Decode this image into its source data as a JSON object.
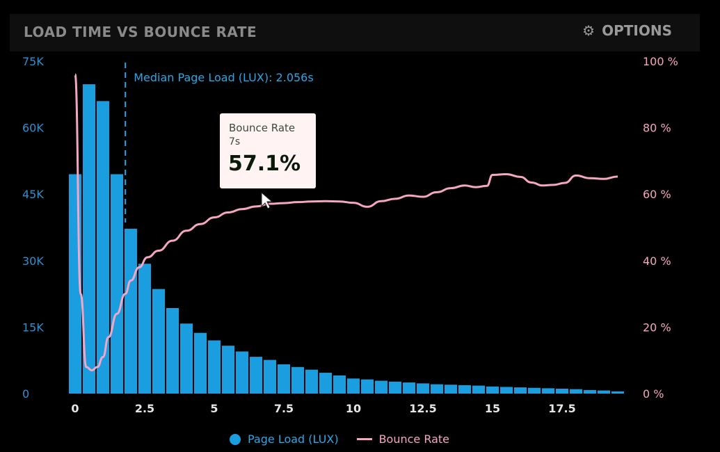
{
  "header": {
    "title": "LOAD TIME VS BOUNCE RATE",
    "options_label": "OPTIONS",
    "options_icon": "gear-icon"
  },
  "colors": {
    "bars": "#1a9ee0",
    "line": "#f5a6c4",
    "left_axis": "#2f8fd0",
    "right_axis": "#f5a6c4",
    "median_line": "#2aa6e6"
  },
  "tooltip": {
    "label": "Bounce Rate",
    "x": "7s",
    "value": "57.1%"
  },
  "chart_data": {
    "type": "bar",
    "title": "LOAD TIME VS BOUNCE RATE",
    "x_ticks": [
      0,
      2.5,
      5,
      7.5,
      10,
      12.5,
      15,
      17.5
    ],
    "x_tick_labels": [
      "0",
      "2.5",
      "5",
      "7.5",
      "10",
      "12.5",
      "15",
      "17.5"
    ],
    "xlim": [
      0,
      20
    ],
    "y_left_ticks": [
      "0",
      "15K",
      "30K",
      "45K",
      "60K",
      "75K"
    ],
    "y_left_lim": [
      0,
      75000
    ],
    "y_right_ticks": [
      "0 %",
      "20 %",
      "40 %",
      "60 %",
      "80 %",
      "100 %"
    ],
    "y_right_lim": [
      0,
      100
    ],
    "bin_width": 0.5,
    "bars": {
      "name": "Page Load (LUX)",
      "x": [
        0,
        0.5,
        1,
        1.5,
        2,
        2.5,
        3,
        3.5,
        4,
        4.5,
        5,
        5.5,
        6,
        6.5,
        7,
        7.5,
        8,
        8.5,
        9,
        9.5,
        10,
        10.5,
        11,
        11.5,
        12,
        12.5,
        13,
        13.5,
        14,
        14.5,
        15,
        15.5,
        16,
        16.5,
        17,
        17.5,
        18,
        18.5,
        19,
        19.5
      ],
      "values": [
        49500,
        69800,
        66000,
        49500,
        37200,
        29300,
        23600,
        19300,
        15800,
        13700,
        12000,
        10800,
        9500,
        8300,
        7600,
        6600,
        6000,
        5400,
        4700,
        4100,
        3400,
        3200,
        2900,
        2700,
        2500,
        2300,
        2100,
        2000,
        1900,
        1800,
        1600,
        1500,
        1400,
        1300,
        1200,
        1100,
        1000,
        800,
        700,
        500
      ]
    },
    "line": {
      "name": "Bounce Rate",
      "x": [
        0,
        0.2,
        0.4,
        0.6,
        0.8,
        1.0,
        1.2,
        1.5,
        1.8,
        2.0,
        2.3,
        2.6,
        3.0,
        3.5,
        4.0,
        4.5,
        5.0,
        5.5,
        6.0,
        6.5,
        7.0,
        7.5,
        8.0,
        8.5,
        9.0,
        9.5,
        10.0,
        10.5,
        11.0,
        11.5,
        12.0,
        12.5,
        13.0,
        13.5,
        14.0,
        14.4,
        14.8,
        15.0,
        15.5,
        16.0,
        16.4,
        16.8,
        17.2,
        17.6,
        18.0,
        18.5,
        19.0,
        19.5
      ],
      "values": [
        96,
        30,
        8,
        7,
        8,
        11,
        17,
        24,
        30,
        34,
        38,
        41,
        43,
        46,
        49,
        51,
        53,
        54.5,
        55.5,
        56.3,
        57.1,
        57.3,
        57.6,
        57.8,
        57.9,
        57.8,
        57.4,
        56.2,
        57.9,
        58.6,
        59.6,
        59.2,
        60.6,
        61.8,
        62.6,
        62.1,
        62.5,
        65.8,
        66,
        65.2,
        63.5,
        62.6,
        62.8,
        63.4,
        65.6,
        64.8,
        64.6,
        65.3
      ]
    },
    "median_marker": {
      "label": "Median Page Load (LUX): 2.056s",
      "x": 2.056
    },
    "legend": [
      "Page Load (LUX)",
      "Bounce Rate"
    ],
    "legend_position": "bottom-center",
    "grid": false
  }
}
